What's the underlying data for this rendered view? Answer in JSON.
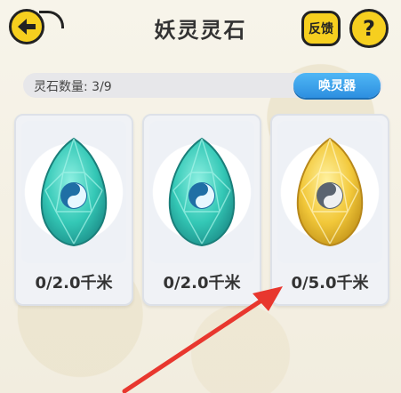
{
  "header": {
    "title": "妖灵灵石",
    "feedback_label": "反馈",
    "help_label": "?"
  },
  "stone_bar": {
    "count_label": "灵石数量: 3/9",
    "summon_label": "唤灵器"
  },
  "stones": [
    {
      "color": "teal",
      "distance": "0/2.0千米"
    },
    {
      "color": "teal",
      "distance": "0/2.0千米"
    },
    {
      "color": "gold",
      "distance": "0/5.0千米"
    }
  ],
  "colors": {
    "button_yellow": "#f6cf1f",
    "summon_blue": "#3aa3ee",
    "annotation_arrow": "#e8372e"
  }
}
